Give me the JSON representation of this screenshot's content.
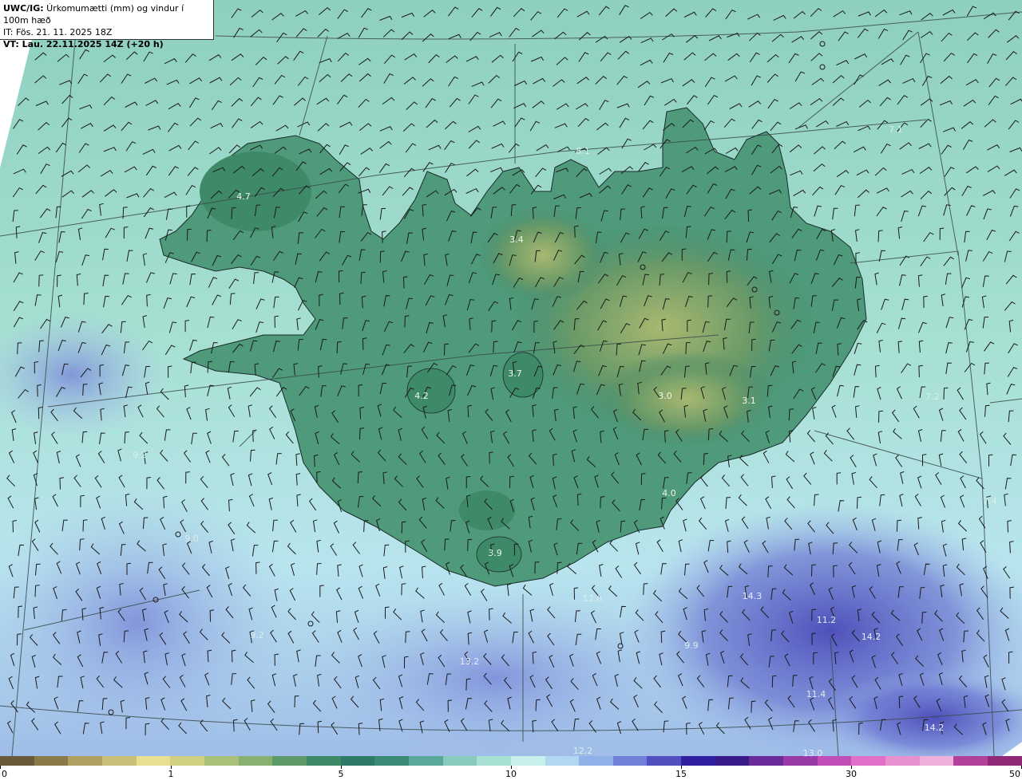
{
  "header": {
    "title_prefix": "UWC/IG:",
    "title_text": " Úrkomumætti (mm) og vindur í 100m hæð",
    "it_line": "IT: Fös. 21. 11. 2025 18Z",
    "vt_line": "VT: Lau. 22.11.2025 14Z (+20 h)"
  },
  "colorbar": {
    "ticks": [
      "0",
      "1",
      "5",
      "10",
      "15",
      "30",
      "50"
    ],
    "colors": [
      "#6a5a3a",
      "#8a7a4a",
      "#b0a060",
      "#c8c078",
      "#e8e090",
      "#d0d080",
      "#a8c078",
      "#88b070",
      "#5e9a68",
      "#3e8a68",
      "#2e7a68",
      "#3a8a78",
      "#5aa89a",
      "#8acabc",
      "#a8e0d4",
      "#c8f0ea",
      "#b0d8f0",
      "#90b0e8",
      "#7080d8",
      "#5050c0",
      "#3020a0",
      "#3a1a88",
      "#6a2a98",
      "#9a3aa8",
      "#c050b8",
      "#e070c8",
      "#e890d0",
      "#f0b0dc",
      "#b04098",
      "#902878"
    ]
  },
  "map": {
    "value_labels": [
      {
        "text": "4.7",
        "kind": "land"
      },
      {
        "text": "3.4",
        "kind": "land"
      },
      {
        "text": "8.1",
        "kind": "sea"
      },
      {
        "text": "7.1",
        "kind": "sea"
      },
      {
        "text": "3.7",
        "kind": "land"
      },
      {
        "text": "4.2",
        "kind": "land"
      },
      {
        "text": "3.0",
        "kind": "land"
      },
      {
        "text": "3.1",
        "kind": "land"
      },
      {
        "text": "7.2",
        "kind": "sea"
      },
      {
        "text": "4.0",
        "kind": "land"
      },
      {
        "text": "3.9",
        "kind": "land"
      },
      {
        "text": "12.6",
        "kind": "sea"
      },
      {
        "text": "14.3",
        "kind": "dark"
      },
      {
        "text": "14.2",
        "kind": "dark"
      },
      {
        "text": "13.2",
        "kind": "dark"
      },
      {
        "text": "9.2",
        "kind": "sea"
      },
      {
        "text": "9.2",
        "kind": "sea"
      },
      {
        "text": "9.0",
        "kind": "sea"
      },
      {
        "text": "9.9",
        "kind": "sea"
      },
      {
        "text": "11.2",
        "kind": "sea"
      },
      {
        "text": "11.4",
        "kind": "sea"
      },
      {
        "text": "14.2",
        "kind": "dark"
      },
      {
        "text": "12.2",
        "kind": "sea"
      },
      {
        "text": "7.4",
        "kind": "sea"
      },
      {
        "text": "13.0",
        "kind": "dark"
      }
    ]
  }
}
